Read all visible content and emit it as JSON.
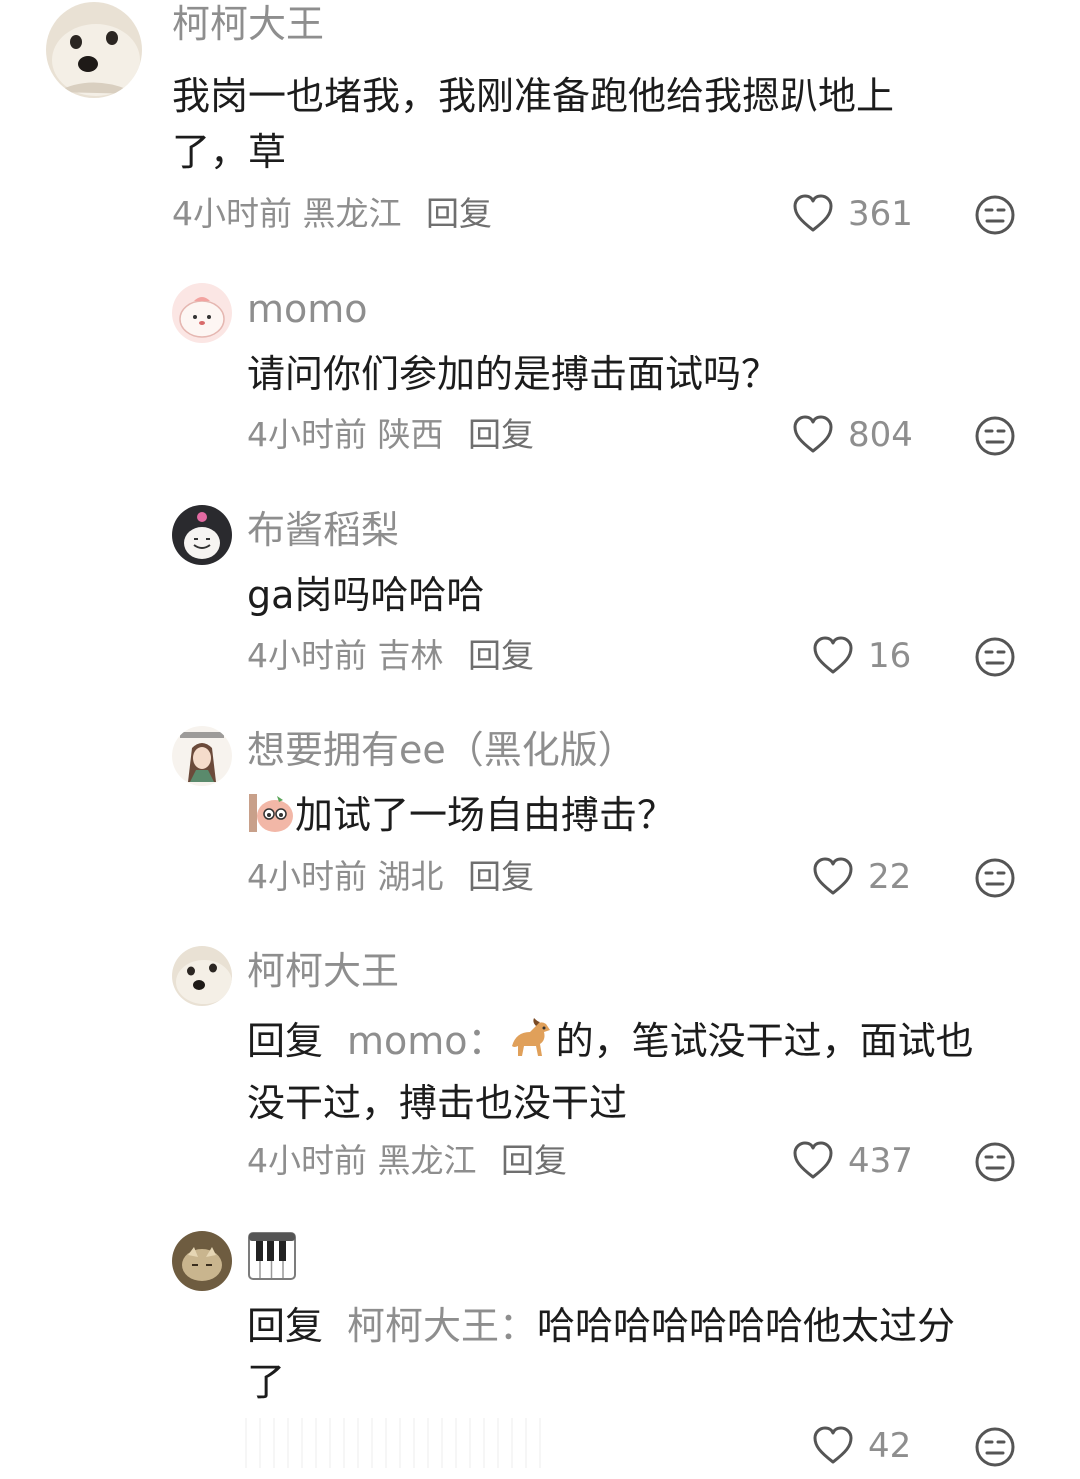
{
  "comments": [
    {
      "username": "柯柯大王",
      "avatar": "dog-avatar",
      "text_line1": "我岗一也堵我，我刚准备跑他给我摁趴地上",
      "text_line2": "了，草",
      "time": "4小时前",
      "location": "黑龙江",
      "reply_label": "回复",
      "likes": "361"
    },
    {
      "username": "momo",
      "avatar": "pink-blob-avatar",
      "text_line1": "请问你们参加的是搏击面试吗？",
      "time": "4小时前",
      "location": "陕西",
      "reply_label": "回复",
      "likes": "804"
    },
    {
      "username": "布酱稻梨",
      "avatar": "kuromi-avatar",
      "text_line1": "ga岗吗哈哈哈",
      "time": "4小时前",
      "location": "吉林",
      "reply_label": "回复",
      "likes": "16"
    },
    {
      "username": "想要拥有ee（黑化版）",
      "avatar": "anime-girl-avatar",
      "text_line1": "加试了一场自由搏击？",
      "emoji": "peeking-sticker",
      "time": "4小时前",
      "location": "湖北",
      "reply_label": "回复",
      "likes": "22"
    },
    {
      "username": "柯柯大王",
      "avatar": "dog-avatar",
      "reply_prefix": "回复",
      "reply_target": "momo：",
      "emoji": "horse-emoji",
      "text_line1": "的，笔试没干过，面试也",
      "text_line2": "没干过，搏击也没干过",
      "time": "4小时前",
      "location": "黑龙江",
      "reply_label": "回复",
      "likes": "437"
    },
    {
      "username_icon": "piano-emoji",
      "avatar": "cat-avatar",
      "reply_prefix": "回复",
      "reply_target": "柯柯大王：",
      "text_line1": "哈哈哈哈哈哈哈他太过分",
      "text_line2": "了",
      "likes": "42"
    }
  ],
  "colors": {
    "name": "#8e8e8e",
    "text": "#1c1c1c",
    "meta": "#8e8e8e",
    "icon": "#555555"
  }
}
